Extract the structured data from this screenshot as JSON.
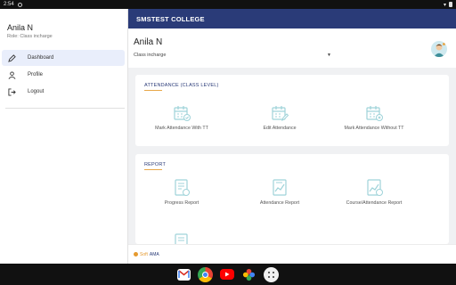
{
  "status_bar": {
    "time": "2:54"
  },
  "drawer": {
    "user_name": "Anila N",
    "user_role": "Role: Class incharge",
    "items": [
      {
        "label": "Dashboard",
        "icon": "pencil-icon",
        "active": true
      },
      {
        "label": "Profile",
        "icon": "person-icon",
        "active": false
      },
      {
        "label": "Logout",
        "icon": "logout-icon",
        "active": false
      }
    ]
  },
  "topbar": {
    "title": "SMSTEST COLLEGE"
  },
  "header": {
    "name": "Anila N",
    "role_value": "Class incharge"
  },
  "attendance": {
    "title": "ATTENDANCE (CLASS LEVEL)",
    "tiles": [
      {
        "label": "Mark Attendance With TT",
        "icon": "calendar-icon"
      },
      {
        "label": "Edit Attendance",
        "icon": "calendar-icon"
      },
      {
        "label": "Mark Attendance Without TT",
        "icon": "calendar-icon"
      }
    ]
  },
  "report": {
    "title": "REPORT",
    "tiles": [
      {
        "label": "Progress Report",
        "icon": "report-icon"
      },
      {
        "label": "Attendance Report",
        "icon": "report-icon"
      },
      {
        "label": "Course/Attendance Report",
        "icon": "report-icon"
      }
    ]
  },
  "footer": {
    "part1": "Soft",
    "part2": "AMA"
  },
  "colors": {
    "primary": "#2a3b78",
    "accent": "#e8a84a",
    "icon": "#9fd3d9",
    "active_bg": "#e9eefb"
  },
  "taskbar": [
    "gmail-icon",
    "chrome-icon",
    "youtube-icon",
    "photos-icon",
    "app-drawer-icon"
  ]
}
